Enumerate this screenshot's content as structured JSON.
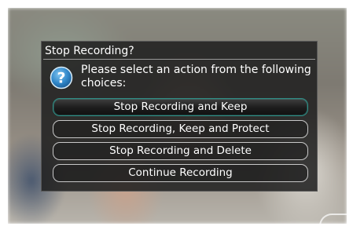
{
  "dialog": {
    "title": "Stop Recording?",
    "message": "Please select an action from the following choices:",
    "icon": "question-icon",
    "options": [
      {
        "label": "Stop Recording and Keep",
        "selected": true
      },
      {
        "label": "Stop Recording, Keep and Protect",
        "selected": false
      },
      {
        "label": "Stop Recording and Delete",
        "selected": false
      },
      {
        "label": "Continue Recording",
        "selected": false
      }
    ]
  },
  "colors": {
    "dialog_bg": "#1e1e1e",
    "selected_border": "#2f8f86",
    "icon_blue": "#2f86c8"
  }
}
